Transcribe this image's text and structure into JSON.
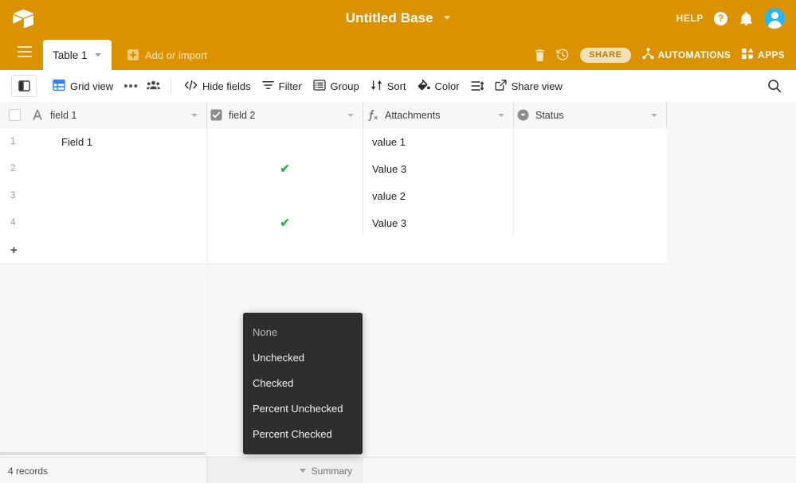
{
  "topbar": {
    "logo_icon": "airtable-cube-icon",
    "base_title": "Untitled Base",
    "base_caret_icon": "chevron-down-icon",
    "help_label": "HELP",
    "help_icon": "question-mark-icon",
    "notifications_icon": "bell-icon",
    "avatar_icon": "user-avatar-icon",
    "accent_color": "#db9200"
  },
  "tabbar": {
    "menu_icon": "hamburger-menu-icon",
    "active_tab": "Table 1",
    "tab_caret_icon": "chevron-down-icon",
    "add_import_label": "Add or import",
    "add_import_icon": "plus-square-icon",
    "trash_icon": "trash-icon",
    "history_icon": "clock-history-icon",
    "share_label": "SHARE",
    "automations_label": "AUTOMATIONS",
    "automations_icon": "automations-node-icon",
    "apps_label": "APPS",
    "apps_icon": "apps-grid-icon"
  },
  "toolbar": {
    "sidebar_toggle_icon": "sidebar-panel-icon",
    "view_icon": "grid-view-icon",
    "view_label": "Grid view",
    "more_icon": "ellipsis-icon",
    "collaborators_icon": "people-icon",
    "items": [
      {
        "label": "Hide fields",
        "icon": "hide-fields-icon"
      },
      {
        "label": "Filter",
        "icon": "filter-icon"
      },
      {
        "label": "Group",
        "icon": "group-icon"
      },
      {
        "label": "Sort",
        "icon": "sort-icon"
      },
      {
        "label": "Color",
        "icon": "color-paint-icon"
      }
    ],
    "row_height_icon": "row-height-icon",
    "share_view_label": "Share view",
    "share_view_icon": "share-external-icon",
    "search_icon": "search-icon"
  },
  "grid": {
    "select_all_icon": "checkbox-unchecked-icon",
    "columns": [
      {
        "name": "field 1",
        "type_icon": "text-field-icon",
        "caret_icon": "chevron-down-icon"
      },
      {
        "name": "field 2",
        "type_icon": "checkbox-field-icon",
        "caret_icon": "chevron-down-icon"
      },
      {
        "name": "Attachments",
        "type_icon": "formula-field-icon",
        "caret_icon": "chevron-down-icon"
      },
      {
        "name": "Status",
        "type_icon": "single-select-field-icon",
        "caret_icon": "chevron-down-icon"
      }
    ],
    "rows": [
      {
        "num": "1",
        "field1": "Field 1",
        "field2": "",
        "attachments": "value 1",
        "status": ""
      },
      {
        "num": "2",
        "field1": "",
        "field2": "✔",
        "attachments": "Value 3",
        "status": ""
      },
      {
        "num": "3",
        "field1": "",
        "field2": "",
        "attachments": "value 2",
        "status": ""
      },
      {
        "num": "4",
        "field1": "",
        "field2": "✔",
        "attachments": "Value 3",
        "status": ""
      }
    ],
    "add_row_icon": "plus-icon",
    "checkmark_color": "#2eb34a"
  },
  "context_menu": {
    "items": [
      {
        "label": "None",
        "dimmed": true
      },
      {
        "label": "Unchecked",
        "dimmed": false
      },
      {
        "label": "Checked",
        "dimmed": false
      },
      {
        "label": "Percent Unchecked",
        "dimmed": false
      },
      {
        "label": "Percent Checked",
        "dimmed": false
      }
    ]
  },
  "footer": {
    "records_label": "4 records",
    "summary_label": "Summary",
    "summary_caret_icon": "caret-down-icon"
  }
}
